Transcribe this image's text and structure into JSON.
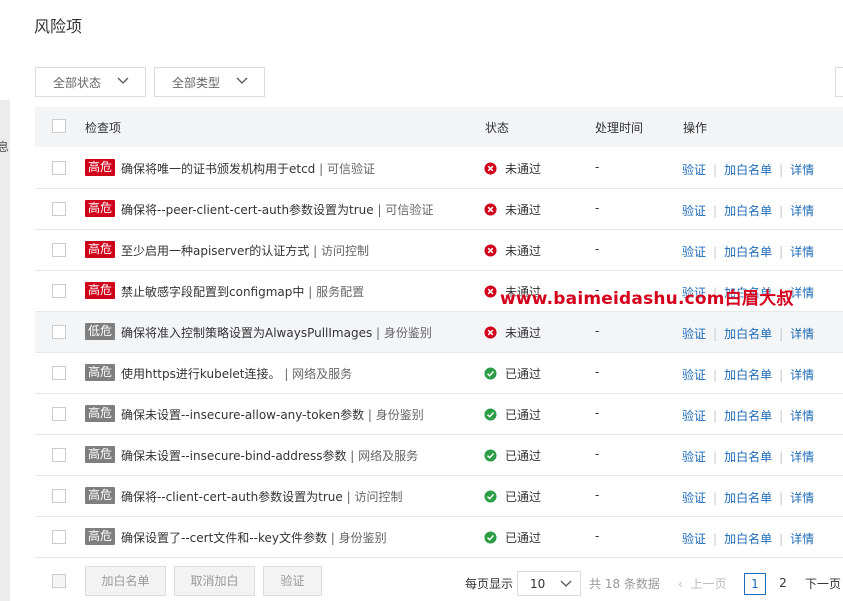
{
  "page": {
    "title": "风险项"
  },
  "side_fragment": "息",
  "filters": {
    "status_label": "全部状态",
    "type_label": "全部类型"
  },
  "table": {
    "headers": {
      "item": "检查项",
      "status": "状态",
      "time": "处理时间",
      "ops": "操作"
    },
    "rows": [
      {
        "level": "高危",
        "level_color": "red",
        "name": "确保将唯一的证书颁发机构用于etcd",
        "category": "可信验证",
        "status": "未通过",
        "status_type": "fail",
        "time": "-"
      },
      {
        "level": "高危",
        "level_color": "red",
        "name": "确保将--peer-client-cert-auth参数设置为true",
        "category": "可信验证",
        "status": "未通过",
        "status_type": "fail",
        "time": "-"
      },
      {
        "level": "高危",
        "level_color": "red",
        "name": "至少启用一种apiserver的认证方式",
        "category": "访问控制",
        "status": "未通过",
        "status_type": "fail",
        "time": "-"
      },
      {
        "level": "高危",
        "level_color": "red",
        "name": "禁止敏感字段配置到configmap中",
        "category": "服务配置",
        "status": "未通过",
        "status_type": "fail",
        "time": "-"
      },
      {
        "level": "低危",
        "level_color": "gray",
        "name": "确保将准入控制策略设置为AlwaysPullImages",
        "category": "身份鉴别",
        "status": "未通过",
        "status_type": "fail",
        "time": "-"
      },
      {
        "level": "高危",
        "level_color": "gray",
        "name": "使用https进行kubelet连接。",
        "category": "网络及服务",
        "status": "已通过",
        "status_type": "pass",
        "time": "-"
      },
      {
        "level": "高危",
        "level_color": "gray",
        "name": "确保未设置--insecure-allow-any-token参数",
        "category": "身份鉴别",
        "status": "已通过",
        "status_type": "pass",
        "time": "-"
      },
      {
        "level": "高危",
        "level_color": "gray",
        "name": "确保未设置--insecure-bind-address参数",
        "category": "网络及服务",
        "status": "已通过",
        "status_type": "pass",
        "time": "-"
      },
      {
        "level": "高危",
        "level_color": "gray",
        "name": "确保将--client-cert-auth参数设置为true",
        "category": "访问控制",
        "status": "已通过",
        "status_type": "pass",
        "time": "-"
      },
      {
        "level": "高危",
        "level_color": "gray",
        "name": "确保设置了--cert文件和--key文件参数",
        "category": "身份鉴别",
        "status": "已通过",
        "status_type": "pass",
        "time": "-"
      }
    ],
    "row_actions": {
      "verify": "验证",
      "whitelist": "加白名单",
      "detail": "详情"
    }
  },
  "footer": {
    "add_whitelist": "加白名单",
    "cancel_whitelist": "取消加白",
    "verify": "验证",
    "per_page_label": "每页显示",
    "page_size": "10",
    "total": "共 18 条数据",
    "prev": "上一页",
    "pages": [
      "1",
      "2"
    ],
    "next": "下一页"
  },
  "watermark": "www.baimeidashu.com白眉大叔",
  "colors": {
    "fail": "#d0021b",
    "pass": "#2a9d46",
    "link": "#1e6bb8",
    "high": "#d0021b",
    "muted": "#7f7f7f"
  }
}
